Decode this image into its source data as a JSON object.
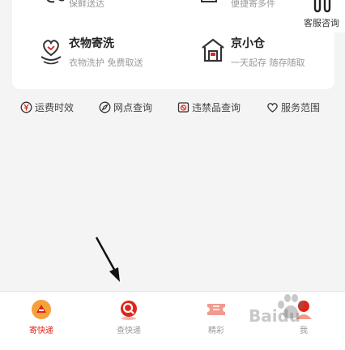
{
  "top_row": {
    "left_sub": "保鲜送达",
    "right_sub": "便捷寄多件"
  },
  "services": [
    {
      "title": "衣物寄洗",
      "sub": "衣物洗护 免费取送",
      "icon": "clothes-wash-icon"
    },
    {
      "title": "京小仓",
      "sub": "一天起存 随存随取",
      "icon": "warehouse-icon"
    }
  ],
  "customer_service": {
    "label": "客服咨询",
    "icon": "headset-icon"
  },
  "quick_links": [
    {
      "label": "运费时效",
      "icon": "yen-circle-icon"
    },
    {
      "label": "网点查询",
      "icon": "compass-icon"
    },
    {
      "label": "违禁品查询",
      "icon": "prohibited-items-icon"
    },
    {
      "label": "服务范围",
      "icon": "heart-icon"
    }
  ],
  "tabs": [
    {
      "label": "寄快递",
      "icon": "send-express-icon",
      "active": true
    },
    {
      "label": "查快递",
      "icon": "search-express-icon",
      "active": false
    },
    {
      "label": "精彩",
      "icon": "ticket-icon",
      "active": false
    },
    {
      "label": "我",
      "icon": "user-icon",
      "active": false
    }
  ],
  "watermark": {
    "text": "Baidu",
    "icon": "baidu-paw-icon"
  },
  "colors": {
    "accent": "#e1251b",
    "background": "#f4f4f4",
    "muted_text": "#999999"
  }
}
